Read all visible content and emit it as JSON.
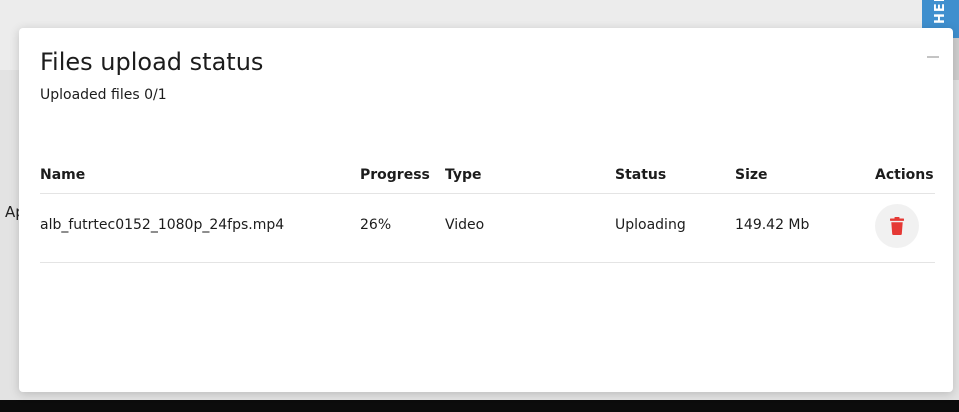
{
  "background": {
    "partial_text": "Ap",
    "help_tab_label": "HEL"
  },
  "modal": {
    "title": "Files upload status",
    "subtitle": "Uploaded files 0/1",
    "columns": {
      "name": "Name",
      "progress": "Progress",
      "type": "Type",
      "status": "Status",
      "size": "Size",
      "actions": "Actions"
    },
    "rows": [
      {
        "name": "alb_futrtec0152_1080p_24fps.mp4",
        "progress": "26%",
        "type": "Video",
        "status": "Uploading",
        "size": "149.42 Mb"
      }
    ]
  },
  "colors": {
    "delete_icon": "#e53935",
    "help_tab": "#3f8fce"
  },
  "icons": {
    "delete": "trash-icon",
    "minimize": "minimize-icon"
  }
}
